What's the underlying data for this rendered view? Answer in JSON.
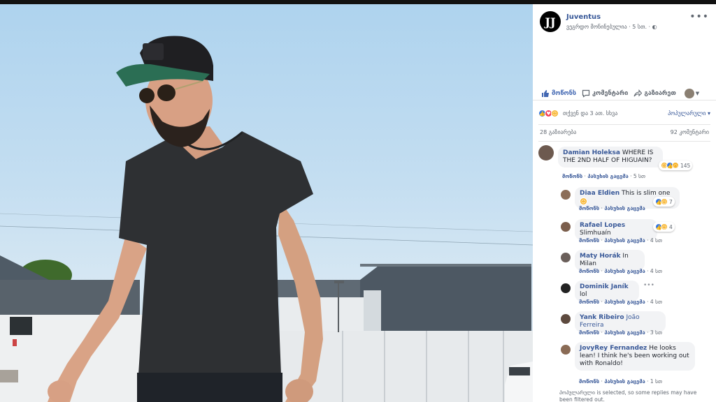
{
  "post": {
    "page_name": "Juventus",
    "page_logo": "JJ",
    "meta": "ვეგრდო მონინებულია · 5 სთ. ·",
    "globe_icon": "globe-icon"
  },
  "actions": {
    "like": "მოწონს",
    "comment": "კომენტარი",
    "share": "გაზიარეთ"
  },
  "reactions": {
    "summary": "თქვენ და 3 ათ. სხვა",
    "sort": "პოპულარული ▾"
  },
  "counts": {
    "shares": "28 გაზიარება",
    "comments": "92 კომენტარი"
  },
  "comments": [
    {
      "author": "Damian Holeksa",
      "text": "WHERE IS THE 2ND HALF OF HIGUAIN?",
      "reply_like": "მოწონს",
      "reply": "პასუხის გაცემა",
      "time": "5 სთ",
      "reaction_count": "145"
    },
    {
      "author": "Diaa Eldien",
      "text": "This is slim one",
      "reply_like": "მოწონს",
      "reply": "პასუხის გაცემა",
      "time": "4 სთ",
      "reaction_count": "7"
    },
    {
      "author": "Rafael Lopes",
      "text": "Slimhuaín",
      "reply_like": "მოწონს",
      "reply": "პასუხის გაცემა",
      "time": "4 სთ",
      "reaction_count": "4"
    },
    {
      "author": "Maty Horák",
      "text": "In Milan",
      "reply_like": "მოწონს",
      "reply": "პასუხის გაცემა",
      "time": "4 სთ"
    },
    {
      "author": "Dominik Janík",
      "text": "lol",
      "reply_like": "მოწონს",
      "reply": "პასუხის გაცემა",
      "time": "4 სთ"
    },
    {
      "author": "Yank Ribeiro",
      "text": "João Ferreira",
      "reply_like": "მოწონს",
      "reply": "პასუხის გაცემა",
      "time": "3 სთ"
    },
    {
      "author": "JovyRey Fernandez",
      "text": "He looks lean! I think he's been working out with Ronaldo!",
      "reply_like": "მოწონს",
      "reply": "პასუხის გაცემა",
      "time": "1 სთ"
    }
  ],
  "footer_note": "პოპულარული is selected, so some replies may have been filtered out.",
  "colors": {
    "link": "#385898",
    "like_blue": "#4267b2",
    "bubble_bg": "#f2f3f5"
  }
}
